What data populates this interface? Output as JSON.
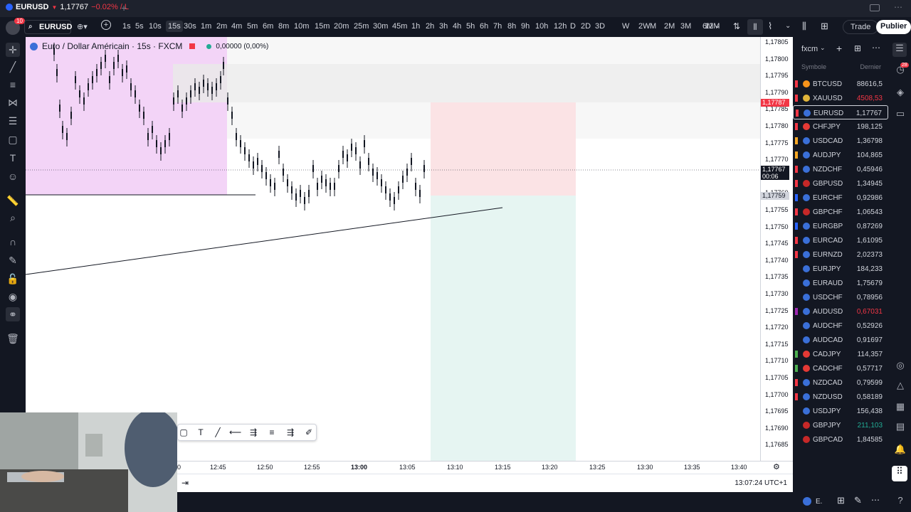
{
  "tabbar": {
    "symbol": "EURUSD",
    "arrow": "▼",
    "price": "1,17767",
    "change": "−0.02% / L",
    "plus": "+"
  },
  "toolbar": {
    "notif_count": "10",
    "symbol": "EURUSD",
    "timeframes": [
      "1s",
      "5s",
      "10s",
      "15s",
      "30s",
      "1m",
      "2m",
      "4m",
      "5m",
      "6m",
      "8m",
      "10m",
      "15m",
      "20m",
      "25m",
      "30m",
      "45m",
      "1h",
      "2h",
      "3h",
      "4h",
      "5h",
      "6h",
      "7h",
      "8h",
      "9h",
      "10h",
      "12h",
      "D",
      "2D",
      "3D",
      "W",
      "2W",
      "M",
      "2M",
      "3M",
      "6M",
      "12M"
    ],
    "active_timeframe": "15s",
    "trade": "Trade",
    "publish": "Publier"
  },
  "legend": {
    "title": "Euro / Dollar Américain · 15s · FXCM",
    "value": "0,00000 (0,00%)"
  },
  "price_scale": {
    "labels": [
      "1,17805",
      "1,17800",
      "1,17795",
      "1,17790",
      "1,17785",
      "1,17780",
      "1,17775",
      "1,17770",
      "1,17765",
      "1,17760",
      "1,17755",
      "1,17750",
      "1,17745",
      "1,17740",
      "1,17735",
      "1,17730",
      "1,17725",
      "1,17720",
      "1,17715",
      "1,17710",
      "1,17705",
      "1,17700",
      "1,17695",
      "1,17690",
      "1,17685"
    ],
    "red_tag": "1,17787",
    "current_tag": "1,17767",
    "countdown": "00:06",
    "gray_tag": "1,17759"
  },
  "time_scale": {
    "labels": [
      "0",
      "12:45",
      "12:50",
      "12:55",
      "13:00",
      "13:05",
      "13:10",
      "13:15",
      "13:20",
      "13:25",
      "13:30",
      "13:35",
      "13:40"
    ],
    "bold": "13:00"
  },
  "status": {
    "clock": "13:07:24 UTC+1"
  },
  "watchlist": {
    "name": "fxcm",
    "col_symbol": "Symbole",
    "col_last": "Dernier",
    "rows": [
      {
        "sym": "BTCUSD",
        "price": "88616,5",
        "color": "#d1d4dc",
        "flag": "#f23645",
        "dot": "#f7931a"
      },
      {
        "sym": "XAUUSD",
        "price": "4508,53",
        "color": "#f23645",
        "flag": "#f23645",
        "dot": "#e0b43a"
      },
      {
        "sym": "EURUSD",
        "price": "1,17767",
        "color": "#d1d4dc",
        "flag": "#f23645",
        "dot": "#3a6fd8"
      },
      {
        "sym": "CHFJPY",
        "price": "198,125",
        "color": "#d1d4dc",
        "flag": "#f23645",
        "dot": "#e53935"
      },
      {
        "sym": "USDCAD",
        "price": "1,36798",
        "color": "#d1d4dc",
        "flag": "#f5a623",
        "dot": "#3a6fd8"
      },
      {
        "sym": "AUDJPY",
        "price": "104,865",
        "color": "#d1d4dc",
        "flag": "#f5a623",
        "dot": "#3a6fd8"
      },
      {
        "sym": "NZDCHF",
        "price": "0,45946",
        "color": "#d1d4dc",
        "flag": "#f23645",
        "dot": "#3a6fd8"
      },
      {
        "sym": "GBPUSD",
        "price": "1,34945",
        "color": "#d1d4dc",
        "flag": "#f23645",
        "dot": "#c62828"
      },
      {
        "sym": "EURCHF",
        "price": "0,92986",
        "color": "#d1d4dc",
        "flag": "#2962ff",
        "dot": "#3a6fd8"
      },
      {
        "sym": "GBPCHF",
        "price": "1,06543",
        "color": "#d1d4dc",
        "flag": "#f23645",
        "dot": "#c62828"
      },
      {
        "sym": "EURGBP",
        "price": "0,87269",
        "color": "#d1d4dc",
        "flag": "#2962ff",
        "dot": "#3a6fd8"
      },
      {
        "sym": "EURCAD",
        "price": "1,61095",
        "color": "#d1d4dc",
        "flag": "#f23645",
        "dot": "#3a6fd8"
      },
      {
        "sym": "EURNZD",
        "price": "2,02373",
        "color": "#d1d4dc",
        "flag": "#f23645",
        "dot": "#3a6fd8"
      },
      {
        "sym": "EURJPY",
        "price": "184,233",
        "color": "#d1d4dc",
        "flag": "",
        "dot": "#3a6fd8"
      },
      {
        "sym": "EURAUD",
        "price": "1,75679",
        "color": "#d1d4dc",
        "flag": "",
        "dot": "#3a6fd8"
      },
      {
        "sym": "USDCHF",
        "price": "0,78956",
        "color": "#d1d4dc",
        "flag": "",
        "dot": "#3a6fd8"
      },
      {
        "sym": "AUDUSD",
        "price": "0,67031",
        "color": "#f23645",
        "flag": "#9c27b0",
        "dot": "#3a6fd8"
      },
      {
        "sym": "AUDCHF",
        "price": "0,52926",
        "color": "#d1d4dc",
        "flag": "",
        "dot": "#3a6fd8"
      },
      {
        "sym": "AUDCAD",
        "price": "0,91697",
        "color": "#d1d4dc",
        "flag": "",
        "dot": "#3a6fd8"
      },
      {
        "sym": "CADJPY",
        "price": "114,357",
        "color": "#d1d4dc",
        "flag": "#4caf50",
        "dot": "#e53935"
      },
      {
        "sym": "CADCHF",
        "price": "0,57717",
        "color": "#d1d4dc",
        "flag": "#4caf50",
        "dot": "#e53935"
      },
      {
        "sym": "NZDCAD",
        "price": "0,79599",
        "color": "#d1d4dc",
        "flag": "#f23645",
        "dot": "#3a6fd8"
      },
      {
        "sym": "NZDUSD",
        "price": "0,58189",
        "color": "#d1d4dc",
        "flag": "#f23645",
        "dot": "#3a6fd8"
      },
      {
        "sym": "USDJPY",
        "price": "156,438",
        "color": "#d1d4dc",
        "flag": "",
        "dot": "#3a6fd8"
      },
      {
        "sym": "GBPJPY",
        "price": "211,103",
        "color": "#22ab94",
        "flag": "",
        "dot": "#c62828"
      },
      {
        "sym": "GBPCAD",
        "price": "1,84585",
        "color": "#d1d4dc",
        "flag": "",
        "dot": "#c62828"
      }
    ]
  },
  "rightbar": {
    "badge": "28"
  },
  "watch_footer": {
    "label": "E."
  },
  "colors": {
    "down": "#f23645",
    "up": "#22ab94",
    "accent": "#2962ff"
  }
}
